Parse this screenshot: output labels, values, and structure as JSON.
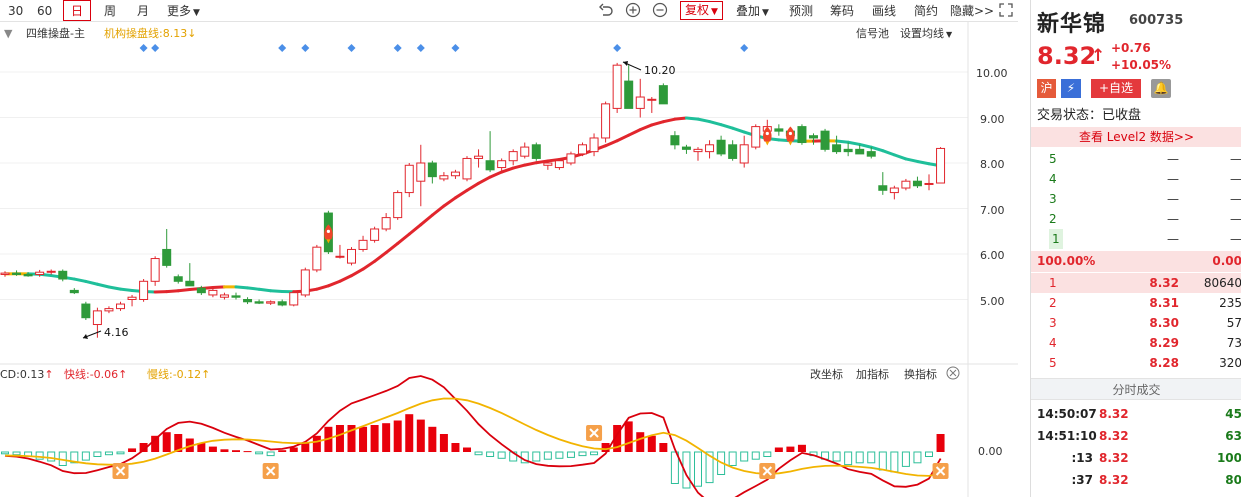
{
  "toolbar": {
    "periods": [
      "30",
      "60",
      "日",
      "周",
      "月"
    ],
    "more": "更多",
    "fuquan": "复权",
    "overlay": "叠加",
    "predict": "预测",
    "chips": "筹码",
    "draw": "画线",
    "simple": "简约",
    "hide": "隐藏>>"
  },
  "chart": {
    "main_label": "四维操盘-主",
    "inst_line_label": "机构操盘线:8.13",
    "signal_pool": "信号池",
    "set_ma": "设置均线",
    "price_axis": [
      "10.00",
      "9.00",
      "8.00",
      "7.00",
      "6.00",
      "5.00"
    ],
    "high_label": "10.20",
    "low_label": "4.16",
    "macd_dif": "CD:0.13",
    "macd_fast": "快线:-0.06",
    "macd_slow": "慢线:-0.12",
    "macd_axis": "0.00",
    "change_axis": "改坐标",
    "add_indicator": "加指标",
    "switch_indicator": "换指标",
    "colors": {
      "up": "#e1262d",
      "down": "#2e9a3a",
      "teal": "#1fbf9a",
      "yellow": "#f2b400",
      "blue": "#4b8fe8"
    }
  },
  "quote": {
    "name": "新华锦",
    "code": "600735",
    "price": "8.32",
    "change": "+0.76",
    "change_pct": "+10.05%",
    "badge_hu": "沪",
    "add_fav": "+自选",
    "trade_status": "交易状态：已收盘",
    "level2": "查看 Level2 数据>>",
    "ratio_left": "100.00%",
    "ratio_right": "0.00",
    "sell_book": [
      {
        "lv": "5",
        "px": "—",
        "vol": "—"
      },
      {
        "lv": "4",
        "px": "—",
        "vol": "—"
      },
      {
        "lv": "3",
        "px": "—",
        "vol": "—"
      },
      {
        "lv": "2",
        "px": "—",
        "vol": "—"
      },
      {
        "lv": "1",
        "px": "—",
        "vol": "—"
      }
    ],
    "buy_book": [
      {
        "lv": "1",
        "px": "8.32",
        "vol": "80640"
      },
      {
        "lv": "2",
        "px": "8.31",
        "vol": "235"
      },
      {
        "lv": "3",
        "px": "8.30",
        "vol": "57"
      },
      {
        "lv": "4",
        "px": "8.29",
        "vol": "73"
      },
      {
        "lv": "5",
        "px": "8.28",
        "vol": "320"
      }
    ],
    "ticks_header": "分时成交",
    "ticks": [
      {
        "time": "14:50:07",
        "px": "8.32",
        "vol": "45"
      },
      {
        "time": "14:51:10",
        "px": "8.32",
        "vol": "63"
      },
      {
        "time": ":13",
        "px": "8.32",
        "vol": "100"
      },
      {
        "time": ":37",
        "px": "8.32",
        "vol": "80"
      }
    ]
  },
  "chart_data": {
    "type": "candlestick",
    "candles": [
      [
        5.55,
        5.62,
        5.5,
        5.58
      ],
      [
        5.58,
        5.64,
        5.52,
        5.55
      ],
      [
        5.55,
        5.6,
        5.5,
        5.52
      ],
      [
        5.55,
        5.65,
        5.5,
        5.6
      ],
      [
        5.6,
        5.66,
        5.55,
        5.62
      ],
      [
        5.62,
        5.66,
        5.4,
        5.45
      ],
      [
        5.2,
        5.25,
        5.12,
        5.15
      ],
      [
        4.9,
        4.95,
        4.55,
        4.6
      ],
      [
        4.45,
        4.82,
        4.16,
        4.75
      ],
      [
        4.75,
        4.85,
        4.7,
        4.8
      ],
      [
        4.8,
        4.95,
        4.75,
        4.9
      ],
      [
        5.0,
        5.1,
        4.85,
        5.05
      ],
      [
        5.0,
        5.45,
        4.95,
        5.4
      ],
      [
        5.4,
        5.95,
        5.3,
        5.9
      ],
      [
        6.1,
        6.55,
        5.7,
        5.75
      ],
      [
        5.5,
        5.55,
        5.35,
        5.4
      ],
      [
        5.4,
        5.8,
        5.3,
        5.3
      ],
      [
        5.25,
        5.3,
        5.1,
        5.15
      ],
      [
        5.1,
        5.25,
        5.05,
        5.2
      ],
      [
        5.05,
        5.15,
        5.0,
        5.1
      ],
      [
        5.08,
        5.15,
        5.0,
        5.05
      ],
      [
        5.0,
        5.05,
        4.9,
        4.95
      ],
      [
        4.95,
        5.0,
        4.9,
        4.92
      ],
      [
        4.92,
        4.98,
        4.88,
        4.95
      ],
      [
        4.95,
        5.0,
        4.85,
        4.88
      ],
      [
        4.88,
        5.2,
        4.85,
        5.15
      ],
      [
        5.1,
        5.7,
        5.05,
        5.65
      ],
      [
        5.65,
        6.2,
        5.6,
        6.15
      ],
      [
        6.9,
        6.95,
        6.0,
        6.05
      ],
      [
        5.95,
        6.2,
        5.9,
        5.95
      ],
      [
        5.8,
        6.15,
        5.75,
        6.1
      ],
      [
        6.1,
        6.4,
        6.05,
        6.3
      ],
      [
        6.3,
        6.6,
        6.25,
        6.55
      ],
      [
        6.55,
        6.9,
        6.5,
        6.8
      ],
      [
        6.8,
        7.4,
        6.75,
        7.35
      ],
      [
        7.35,
        8.0,
        7.25,
        7.95
      ],
      [
        7.6,
        8.4,
        7.05,
        8.0
      ],
      [
        8.0,
        8.05,
        7.55,
        7.7
      ],
      [
        7.65,
        7.8,
        7.6,
        7.72
      ],
      [
        7.72,
        7.85,
        7.65,
        7.8
      ],
      [
        7.65,
        8.15,
        7.6,
        8.1
      ],
      [
        8.1,
        8.3,
        7.9,
        8.15
      ],
      [
        8.05,
        8.7,
        7.8,
        7.85
      ],
      [
        7.9,
        8.1,
        7.8,
        8.05
      ],
      [
        8.05,
        8.3,
        7.95,
        8.25
      ],
      [
        8.15,
        8.45,
        8.1,
        8.35
      ],
      [
        8.4,
        8.45,
        8.05,
        8.1
      ],
      [
        7.95,
        8.05,
        7.85,
        8.0
      ],
      [
        7.9,
        8.1,
        7.85,
        8.05
      ],
      [
        8.0,
        8.25,
        7.95,
        8.2
      ],
      [
        8.2,
        8.45,
        8.15,
        8.4
      ],
      [
        8.25,
        8.65,
        8.15,
        8.55
      ],
      [
        8.55,
        9.35,
        8.45,
        9.3
      ],
      [
        9.2,
        10.2,
        9.1,
        10.15
      ],
      [
        9.8,
        10.15,
        9.2,
        9.2
      ],
      [
        9.2,
        9.85,
        9.0,
        9.45
      ],
      [
        9.4,
        9.45,
        9.1,
        9.4
      ],
      [
        9.7,
        9.75,
        9.3,
        9.3
      ],
      [
        8.6,
        8.7,
        8.3,
        8.4
      ],
      [
        8.35,
        8.4,
        8.2,
        8.3
      ],
      [
        8.25,
        8.35,
        8.05,
        8.3
      ],
      [
        8.25,
        8.5,
        8.1,
        8.4
      ],
      [
        8.5,
        8.6,
        8.15,
        8.2
      ],
      [
        8.4,
        8.5,
        8.05,
        8.1
      ],
      [
        8.0,
        8.6,
        7.9,
        8.4
      ],
      [
        8.35,
        8.85,
        8.3,
        8.8
      ],
      [
        8.7,
        8.95,
        8.55,
        8.8
      ],
      [
        8.75,
        8.85,
        8.6,
        8.7
      ],
      [
        8.7,
        8.75,
        8.55,
        8.6
      ],
      [
        8.8,
        8.85,
        8.4,
        8.45
      ],
      [
        8.6,
        8.65,
        8.4,
        8.55
      ],
      [
        8.7,
        8.75,
        8.25,
        8.3
      ],
      [
        8.4,
        8.6,
        8.2,
        8.25
      ],
      [
        8.3,
        8.45,
        8.15,
        8.25
      ],
      [
        8.3,
        8.4,
        8.2,
        8.2
      ],
      [
        8.25,
        8.35,
        8.1,
        8.15
      ],
      [
        7.5,
        7.8,
        7.3,
        7.4
      ],
      [
        7.35,
        7.5,
        7.2,
        7.45
      ],
      [
        7.45,
        7.65,
        7.4,
        7.6
      ],
      [
        7.6,
        7.7,
        7.45,
        7.5
      ],
      [
        7.55,
        7.75,
        7.4,
        7.55
      ],
      [
        7.56,
        8.35,
        7.55,
        8.32
      ]
    ],
    "ylim": [
      4.0,
      10.6
    ],
    "high": 10.2,
    "low": 4.16,
    "macd_hist": [
      -0.02,
      -0.03,
      -0.05,
      -0.08,
      -0.1,
      -0.15,
      -0.12,
      -0.09,
      -0.05,
      -0.03,
      -0.02,
      0.04,
      0.1,
      0.18,
      0.22,
      0.2,
      0.15,
      0.1,
      0.06,
      0.03,
      0.02,
      0.01,
      -0.02,
      -0.04,
      0.02,
      0.05,
      0.1,
      0.18,
      0.28,
      0.3,
      0.3,
      0.28,
      0.3,
      0.32,
      0.35,
      0.42,
      0.36,
      0.28,
      0.2,
      0.1,
      0.05,
      -0.03,
      -0.05,
      -0.07,
      -0.1,
      -0.12,
      -0.1,
      -0.08,
      -0.07,
      -0.06,
      -0.04,
      -0.03,
      0.1,
      0.3,
      0.34,
      0.22,
      0.18,
      0.1,
      -0.35,
      -0.4,
      -0.38,
      -0.34,
      -0.25,
      -0.15,
      -0.1,
      -0.08,
      -0.05,
      0.05,
      0.06,
      0.08,
      -0.04,
      -0.08,
      -0.1,
      -0.14,
      -0.12,
      -0.12,
      -0.2,
      -0.22,
      -0.16,
      -0.12,
      -0.05,
      0.2
    ]
  }
}
